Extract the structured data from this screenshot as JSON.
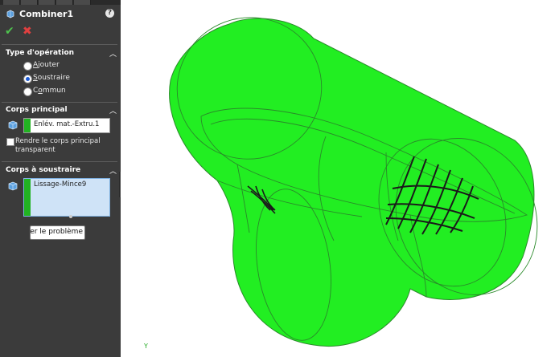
{
  "feature": {
    "title": "Combiner1"
  },
  "sections": {
    "operation": {
      "title": "Type d'opération",
      "options": [
        {
          "label": "Ajouter",
          "selected": false
        },
        {
          "label": "Soustraire",
          "selected": true
        },
        {
          "label": "Commun",
          "selected": false
        }
      ]
    },
    "main_body": {
      "title": "Corps principal",
      "value": "Enlév. mat.-Extru.1",
      "checkbox_label": "Rendre le corps principal transparent",
      "checkbox_checked": false
    },
    "subtract_bodies": {
      "title": "Corps à soustraire",
      "items": [
        "Lissage-Mince9"
      ]
    }
  },
  "tooltip": {
    "text": "fficher le problème"
  },
  "viewport": {
    "axis_label": "Y"
  },
  "colors": {
    "panel_bg": "#3b3b3b",
    "body_green": "#22ee22",
    "body_outline": "#2a9a2a",
    "ok": "#4ec24e",
    "cancel": "#e04040"
  },
  "icons": {
    "feature": "combine-feature-icon",
    "help": "help-icon",
    "ok": "checkmark-icon",
    "cancel": "x-icon",
    "body": "solid-body-icon"
  }
}
